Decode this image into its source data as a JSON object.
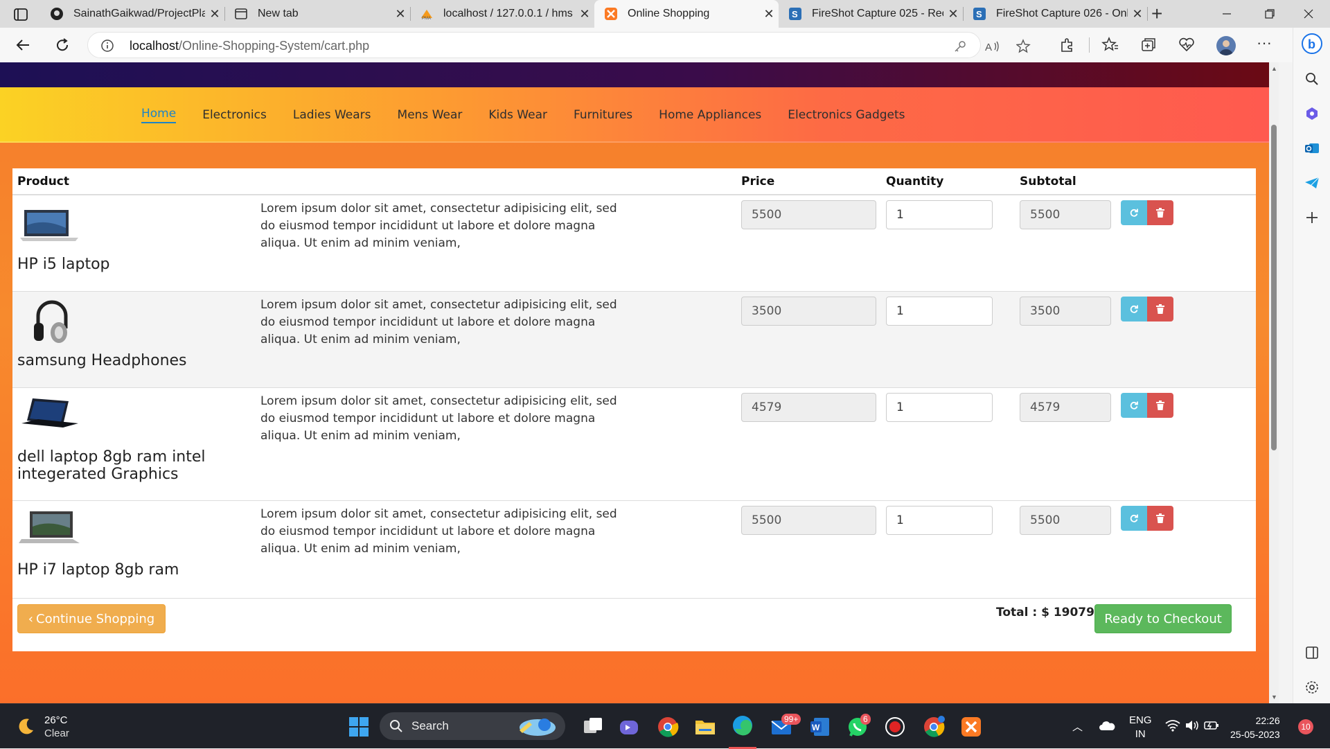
{
  "browser": {
    "tabs": [
      {
        "title": "SainathGaikwad/ProjectPlan",
        "favicon": "github-icon"
      },
      {
        "title": "New tab",
        "favicon": "newtab-icon"
      },
      {
        "title": "localhost / 127.0.0.1 / hms /",
        "favicon": "phpmyadmin-icon"
      },
      {
        "title": "Online Shopping",
        "favicon": "xampp-icon",
        "active": true
      },
      {
        "title": "FireShot Capture 025 - Rece",
        "favicon": "fireshot-icon"
      },
      {
        "title": "FireShot Capture 026 - Onli",
        "favicon": "fireshot-icon"
      }
    ],
    "url_host": "localhost",
    "url_path": "/Online-Shopping-System/cart.php"
  },
  "nav": {
    "items": [
      "Home",
      "Electronics",
      "Ladies Wears",
      "Mens Wear",
      "Kids Wear",
      "Furnitures",
      "Home Appliances",
      "Electronics Gadgets"
    ],
    "active": "Home"
  },
  "cart": {
    "headers": {
      "product": "Product",
      "price": "Price",
      "quantity": "Quantity",
      "subtotal": "Subtotal"
    },
    "items": [
      {
        "name": "HP i5 laptop",
        "image": "laptop-icon",
        "description": "Lorem ipsum dolor sit amet, consectetur adipisicing elit, sed do eiusmod tempor incididunt ut labore et dolore magna aliqua. Ut enim ad minim veniam,",
        "price": "5500",
        "quantity": "1",
        "subtotal": "5500"
      },
      {
        "name": "samsung Headphones",
        "image": "headphones-icon",
        "description": "Lorem ipsum dolor sit amet, consectetur adipisicing elit, sed do eiusmod tempor incididunt ut labore et dolore magna aliqua. Ut enim ad minim veniam,",
        "price": "3500",
        "quantity": "1",
        "subtotal": "3500"
      },
      {
        "name": "dell laptop 8gb ram intel integerated Graphics",
        "image": "laptop-icon",
        "description": "Lorem ipsum dolor sit amet, consectetur adipisicing elit, sed do eiusmod tempor incididunt ut labore et dolore magna aliqua. Ut enim ad minim veniam,",
        "price": "4579",
        "quantity": "1",
        "subtotal": "4579"
      },
      {
        "name": "HP i7 laptop 8gb ram",
        "image": "laptop-icon",
        "description": "Lorem ipsum dolor sit amet, consectetur adipisicing elit, sed do eiusmod tempor incididunt ut labore et dolore magna aliqua. Ut enim ad minim veniam,",
        "price": "5500",
        "quantity": "1",
        "subtotal": "5500"
      }
    ],
    "continue_label": "Continue Shopping",
    "total_label": "Total : $ 19079",
    "checkout_label": "Ready to Checkout"
  },
  "taskbar": {
    "weather_temp": "26°C",
    "weather_desc": "Clear",
    "search_label": "Search",
    "lang_line1": "ENG",
    "lang_line2": "IN",
    "time": "22:26",
    "date": "25-05-2023",
    "notif_count": "10",
    "badge_mail": "99+",
    "badge_whatsapp": "6"
  },
  "colors": {
    "accent_blue": "#1d84c6",
    "warning": "#f0ad4e",
    "success": "#5cb85c",
    "danger": "#d9534f",
    "info": "#5bc0de"
  }
}
